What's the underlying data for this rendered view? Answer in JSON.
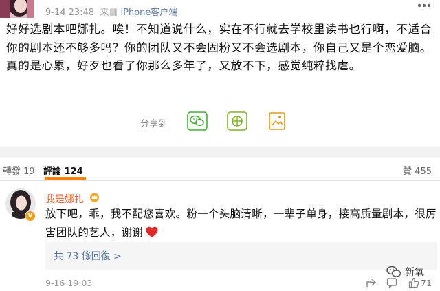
{
  "post": {
    "date": "9-14 23:48",
    "source_prefix": "来自",
    "source": "iPhone客户端",
    "text": "好好选剧本吧娜扎。唉！不知道说什么，实在不行就去学校里读书也行啊，不适合你的剧本还不够多吗？你的团队又不会固粉又不会选剧本，你自己又是个恋爱脑。真的是心累，好歹也看了你那么多年了，又放不下，感觉纯粹找虐。",
    "share_label": "分享到"
  },
  "share": {
    "icons": [
      "wechat-icon",
      "moments-icon",
      "save-image-icon"
    ]
  },
  "tabs": {
    "repost": "轉發 19",
    "comment": "評論 124",
    "like": "贊 455"
  },
  "comment": {
    "username": "我是娜扎",
    "text": "放下吧，乖，我不配您喜欢。粉一个头脑清晰，一辈子单身，接高质量剧本，很厉害团队的艺人，谢谢",
    "reply_link": "共 73 條回復 >",
    "time": "9-16 19:03",
    "like_count": "71"
  },
  "watermark": {
    "text": "新氧"
  },
  "colors": {
    "accent": "#ff8200",
    "username": "#e8632c",
    "link": "#4e6e9e",
    "wechat_green": "#41b035",
    "moments_green": "#7bb32e",
    "save_orange": "#e59a1c"
  }
}
